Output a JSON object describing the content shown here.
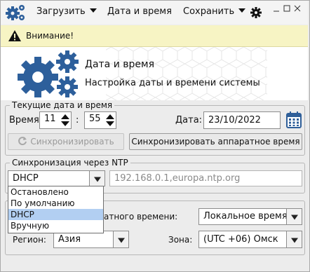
{
  "menubar": {
    "load_label": "Загрузить",
    "datetime_label": "Дата и время",
    "save_label": "Сохранить"
  },
  "warning": {
    "text": "Внимание!"
  },
  "header": {
    "title": "Дата и время",
    "subtitle": "Настройка даты и времени системы"
  },
  "current": {
    "legend": "Текущие дата и время",
    "time_label": "Время:",
    "hours": "11",
    "sep": ":",
    "minutes": "55",
    "date_label": "Дата:",
    "date": "23/10/2022",
    "sync_button": "Синхронизировать",
    "sync_hw_button": "Синхронизировать аппаратное время"
  },
  "ntp": {
    "legend": "Синхронизация через NTP",
    "mode_selected": "DHCP",
    "servers": "192.168.0.1,europa.ntp.org",
    "options": [
      "Остановлено",
      "По умолчанию",
      "DHCP",
      "Вручную"
    ],
    "selected_index": 2
  },
  "zone": {
    "hw_label_tail": "атного времени:",
    "hw_value": "Локальное время",
    "region_label": "Регион:",
    "region_value": "Азия",
    "zone_label": "Зона:",
    "zone_value": "(UTC +06) Омск"
  },
  "icons": {
    "app": "gears-icon",
    "settings": "gear-icon",
    "warning": "warning-triangle-icon",
    "calendar": "calendar-icon",
    "sync": "refresh-icon"
  },
  "colors": {
    "warning_bg": "#f7f4c4",
    "gear_blue": "#2d5f9b",
    "calendar_blue": "#2f5f99",
    "selected_option": "#b2cff2"
  }
}
